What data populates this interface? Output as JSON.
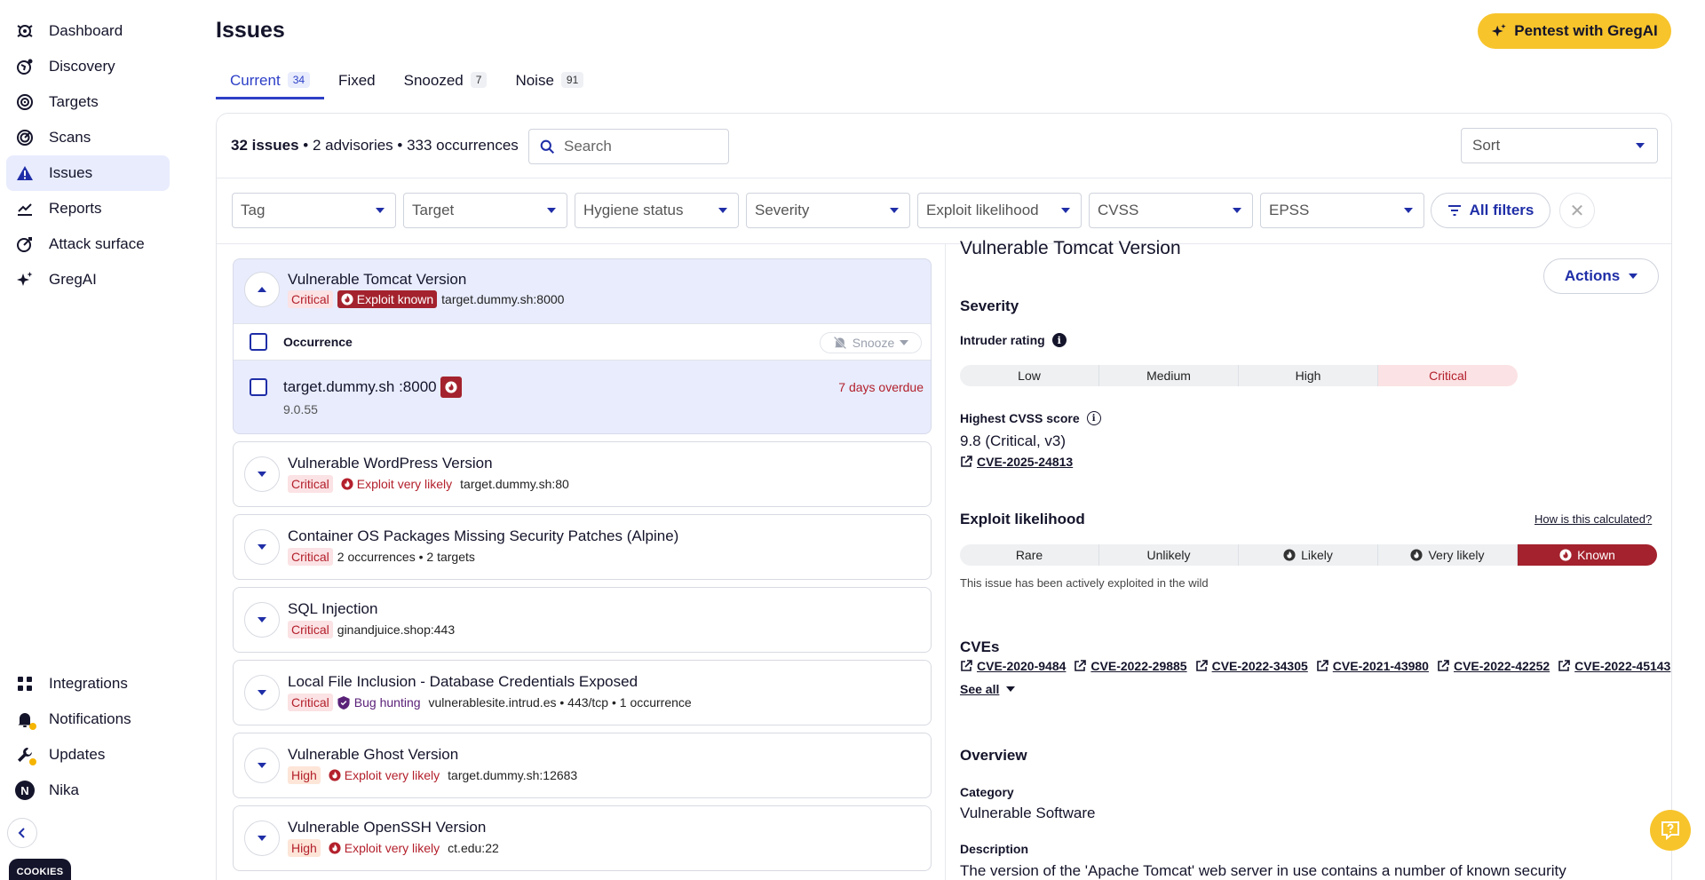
{
  "sidebar": {
    "items": [
      {
        "label": "Dashboard",
        "icon": "dashboard-icon"
      },
      {
        "label": "Discovery",
        "icon": "discovery-icon"
      },
      {
        "label": "Targets",
        "icon": "targets-icon"
      },
      {
        "label": "Scans",
        "icon": "scans-icon"
      },
      {
        "label": "Issues",
        "icon": "warning-icon",
        "active": true
      },
      {
        "label": "Reports",
        "icon": "reports-icon"
      },
      {
        "label": "Attack surface",
        "icon": "attack-surface-icon"
      },
      {
        "label": "GregAI",
        "icon": "sparkle-icon"
      }
    ],
    "bottom": [
      {
        "label": "Integrations",
        "icon": "grid-icon"
      },
      {
        "label": "Notifications",
        "icon": "bell-icon"
      },
      {
        "label": "Updates",
        "icon": "wrench-icon"
      },
      {
        "label": "Nika",
        "icon": "avatar",
        "initial": "N"
      }
    ],
    "cookies": "COOKIES"
  },
  "header": {
    "title": "Issues",
    "pentest_button": "Pentest with GregAI"
  },
  "tabs": [
    {
      "label": "Current",
      "count": "34",
      "active": true
    },
    {
      "label": "Fixed",
      "count": ""
    },
    {
      "label": "Snoozed",
      "count": "7"
    },
    {
      "label": "Noise",
      "count": "91"
    }
  ],
  "summary": {
    "issues": "32 issues",
    "sep1": " • ",
    "advisories": "2 advisories",
    "sep2": " • ",
    "occurrences": "333 occurrences"
  },
  "search": {
    "placeholder": "Search"
  },
  "sort": {
    "label": "Sort"
  },
  "filters": [
    "Tag",
    "Target",
    "Hygiene status",
    "Severity",
    "Exploit likelihood",
    "CVSS",
    "EPSS"
  ],
  "all_filters": "All filters",
  "issues": [
    {
      "title": "Vulnerable Tomcat Version",
      "severity": "Critical",
      "exploit": "Exploit known",
      "target": "target.dummy.sh:8000"
    },
    {
      "title": "Vulnerable WordPress Version",
      "severity": "Critical",
      "exploit": "Exploit very likely",
      "target": "target.dummy.sh:80"
    },
    {
      "title": "Container OS Packages Missing Security Patches (Alpine)",
      "severity": "Critical",
      "extra": "2 occurrences • 2 targets"
    },
    {
      "title": "SQL Injection",
      "severity": "Critical",
      "target": "ginandjuice.shop:443"
    },
    {
      "title": "Local File Inclusion - Database Credentials Exposed",
      "severity": "Critical",
      "tag": "Bug hunting",
      "target": "vulnerablesite.intrud.es • 443/tcp • 1 occurrence"
    },
    {
      "title": "Vulnerable Ghost Version",
      "severity": "High",
      "exploit": "Exploit very likely",
      "target": "target.dummy.sh:12683"
    },
    {
      "title": "Vulnerable OpenSSH Version",
      "severity": "High",
      "exploit": "Exploit very likely",
      "target": "ct.edu:22"
    }
  ],
  "occurrence": {
    "header": "Occurrence",
    "snooze": "Snooze",
    "target": "target.dummy.sh :8000",
    "version": "9.0.55",
    "overdue": "7 days overdue"
  },
  "detail": {
    "title": "Vulnerable Tomcat Version",
    "actions": "Actions",
    "severity_heading": "Severity",
    "intruder_rating": "Intruder rating",
    "rating_scale": [
      "Low",
      "Medium",
      "High",
      "Critical"
    ],
    "rating_selected": "Critical",
    "cvss_heading": "Highest CVSS score",
    "cvss_value": "9.8 (Critical, v3)",
    "cvss_cve": "CVE-2025-24813",
    "exploit_heading": "Exploit likelihood",
    "exploit_link": "How is this calculated?",
    "exploit_scale": [
      "Rare",
      "Unlikely",
      "Likely",
      "Very likely",
      "Known"
    ],
    "exploit_selected": "Known",
    "exploit_note": "This issue has been actively exploited in the wild",
    "cves_heading": "CVEs",
    "cves": [
      "CVE-2020-9484",
      "CVE-2022-29885",
      "CVE-2022-34305",
      "CVE-2021-43980",
      "CVE-2022-42252",
      "CVE-2022-45143"
    ],
    "see_all": "See all",
    "overview_heading": "Overview",
    "category_label": "Category",
    "category_value": "Vulnerable Software",
    "description_label": "Description",
    "description_value": "The version of the 'Apache Tomcat' web server in use contains a number of known security"
  },
  "colors": {
    "accent": "#2d3fc7",
    "brand_yellow": "#f7c42b",
    "critical": "#b3202c",
    "known": "#a3222d"
  }
}
